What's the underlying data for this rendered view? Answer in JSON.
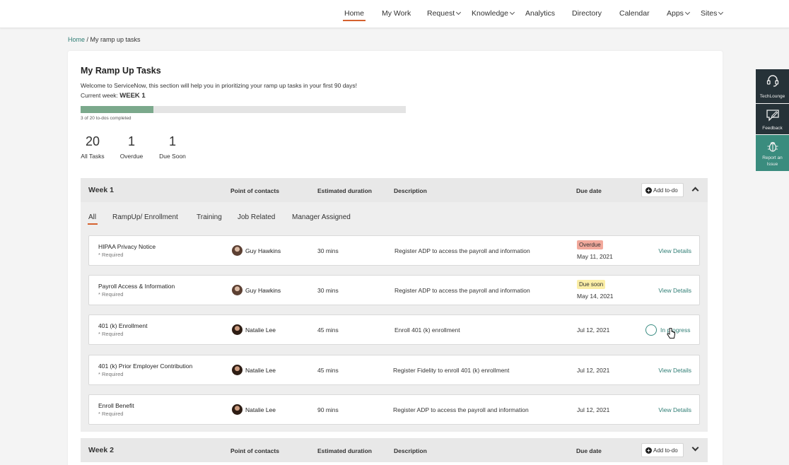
{
  "nav": {
    "items": [
      {
        "label": "Home",
        "dropdown": false
      },
      {
        "label": "My Work",
        "dropdown": false
      },
      {
        "label": "Request",
        "dropdown": true
      },
      {
        "label": "Knowledge",
        "dropdown": true
      },
      {
        "label": "Analytics",
        "dropdown": false
      },
      {
        "label": "Directory",
        "dropdown": false
      },
      {
        "label": "Calendar",
        "dropdown": false
      },
      {
        "label": "Apps",
        "dropdown": true
      },
      {
        "label": "Sites",
        "dropdown": true
      }
    ],
    "active": "Home"
  },
  "breadcrumb": {
    "home": "Home",
    "separator": " / ",
    "current": "My ramp up tasks"
  },
  "header": {
    "title": "My Ramp Up Tasks",
    "welcome": "Welcome to ServiceNow, this section will help you in prioritizing your ramp up tasks in your first 90 days!",
    "current_week_label": "Current week: ",
    "current_week_value": "WEEK 1",
    "progress_fraction": 0.223,
    "progress_text": "3 of 20 to-dos completed"
  },
  "stats": [
    {
      "value": "20",
      "label": "All Tasks"
    },
    {
      "value": "1",
      "label": "Overdue"
    },
    {
      "value": "1",
      "label": "Due Soon"
    }
  ],
  "columns": {
    "contacts": "Point of contacts",
    "duration": "Estimated duration",
    "description": "Description",
    "due": "Due date",
    "add": "Add to-do"
  },
  "weeks": [
    {
      "label": "Week 1",
      "expanded": true
    },
    {
      "label": "Week 2",
      "expanded": false
    }
  ],
  "tabs": [
    "All",
    "RampUp/ Enrollment",
    "Training",
    "Job Related",
    "Manager Assigned"
  ],
  "tasks": [
    {
      "name": "HIPAA Privacy Notice",
      "required": "* Required",
      "contact": "Guy Hawkins",
      "duration": "30 mins",
      "description": "Register ADP to access the payroll and information",
      "badge": "Overdue",
      "badge_color": "#f2a99c",
      "due": "May 11, 2021",
      "action": "View Details"
    },
    {
      "name": "Payroll Access & Information",
      "required": "* Required",
      "contact": "Guy Hawkins",
      "duration": "30 mins",
      "description": "Register ADP to access the payroll and information",
      "badge": "Due soon",
      "badge_color": "#fbeea6",
      "due": "May 14, 2021",
      "action": "View Details"
    },
    {
      "name": "401 (k) Enrollment",
      "required": "* Required",
      "contact": "Natalie Lee",
      "duration": "45 mins",
      "description": "Enroll 401 (k) enrollment",
      "due": "Jul 12, 2021",
      "action": "In progress"
    },
    {
      "name": "401 (k) Prior Employer  Contribution",
      "required": "* Required",
      "contact": "Natalie Lee",
      "duration": "45 mins",
      "description": "Register Fidelity to enroll 401 (k) enrollment",
      "due": "Jul 12, 2021",
      "action": "View Details"
    },
    {
      "name": "Enroll Benefit",
      "required": "* Required",
      "contact": "Natalie Lee",
      "duration": "90 mins",
      "description": "Register ADP to access the payroll and information",
      "due": "Jul 12, 2021",
      "action": "View Details"
    }
  ],
  "sidepanel": [
    {
      "label": "TechLounge",
      "icon": "headset-icon"
    },
    {
      "label": "Feedback",
      "icon": "feedback-icon"
    },
    {
      "label": "Report an Issue",
      "icon": "bug-icon"
    }
  ],
  "colors": {
    "accent": "#d5622f",
    "teal": "#2e7d74",
    "progress": "#7ba98c",
    "panel": "#263238",
    "panel_highlight": "#3a8c7e"
  }
}
